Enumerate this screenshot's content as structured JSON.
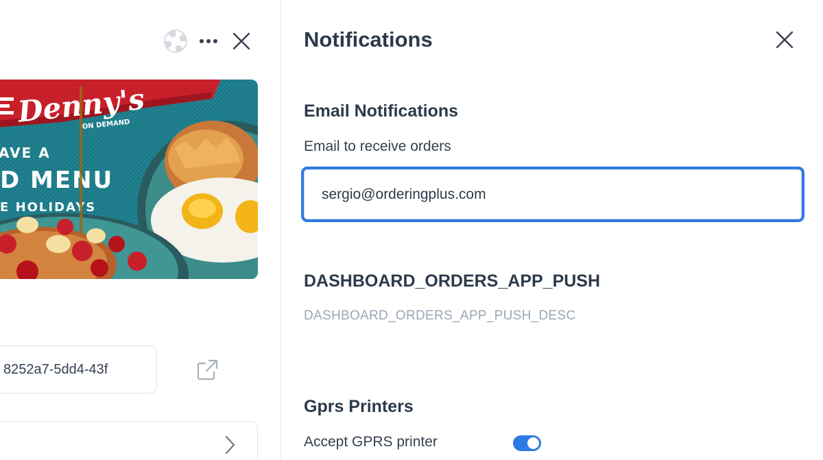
{
  "left": {
    "banner": {
      "brand": "Denny's",
      "subbrand": "ON DEMAND",
      "line1": "AVE A",
      "line2": "D MENU",
      "line3": "E HOLIDAYS"
    },
    "uuid_text": "8252a7-5dd4-43f"
  },
  "notifications": {
    "title": "Notifications",
    "email": {
      "heading": "Email Notifications",
      "label": "Email to receive orders",
      "value": "sergio@orderingplus.com"
    },
    "app_push": {
      "heading": "DASHBOARD_ORDERS_APP_PUSH",
      "description": "DASHBOARD_ORDERS_APP_PUSH_DESC"
    },
    "gprs": {
      "heading": "Gprs Printers",
      "accept_label": "Accept GPRS printer",
      "accept_enabled": true
    }
  },
  "colors": {
    "accent": "#2c7be5",
    "title_text": "#2c3a4b",
    "muted_text": "#9aa6b5",
    "border": "#dfe3e8"
  },
  "icons": {
    "help": "lifebuoy-icon",
    "more": "more-horizontal-icon",
    "close": "close-icon",
    "external": "external-link-icon",
    "chevron": "chevron-right-icon"
  }
}
